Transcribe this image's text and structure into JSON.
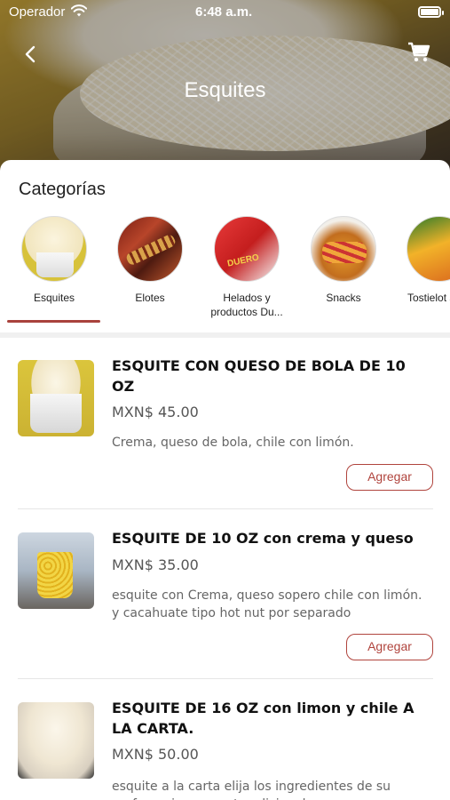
{
  "status_bar": {
    "carrier": "Operador",
    "time": "6:48 a.m."
  },
  "header": {
    "title": "Esquites",
    "back_icon": "chevron-left-icon",
    "cart_icon": "cart-icon"
  },
  "categories_title": "Categorías",
  "categories": [
    {
      "label": "Esquites",
      "selected": true
    },
    {
      "label": "Elotes",
      "selected": false
    },
    {
      "label": "Helados y productos Du...",
      "selected": false
    },
    {
      "label": "Snacks",
      "selected": false
    },
    {
      "label": "Tostielot sabrielo",
      "selected": false
    }
  ],
  "products": [
    {
      "name": "ESQUITE CON QUESO DE BOLA DE 10 OZ",
      "price": "MXN$ 45.00",
      "description": "Crema, queso de bola, chile con limón.",
      "add_label": "Agregar"
    },
    {
      "name": "ESQUITE DE 10 OZ con crema y queso",
      "price": "MXN$ 35.00",
      "description": "esquite con Crema, queso sopero chile con limón. y cacahuate tipo hot nut por separado",
      "add_label": "Agregar"
    },
    {
      "name": "ESQUITE DE 16 OZ con limon y chile A LA CARTA.",
      "price": "MXN$ 50.00",
      "description": "esquite a la carta elija los ingredientes de su preferencia con costo adicional",
      "add_label": "Agregar"
    }
  ],
  "colors": {
    "accent": "#b0443d",
    "text": "#111111",
    "muted": "#666666"
  }
}
